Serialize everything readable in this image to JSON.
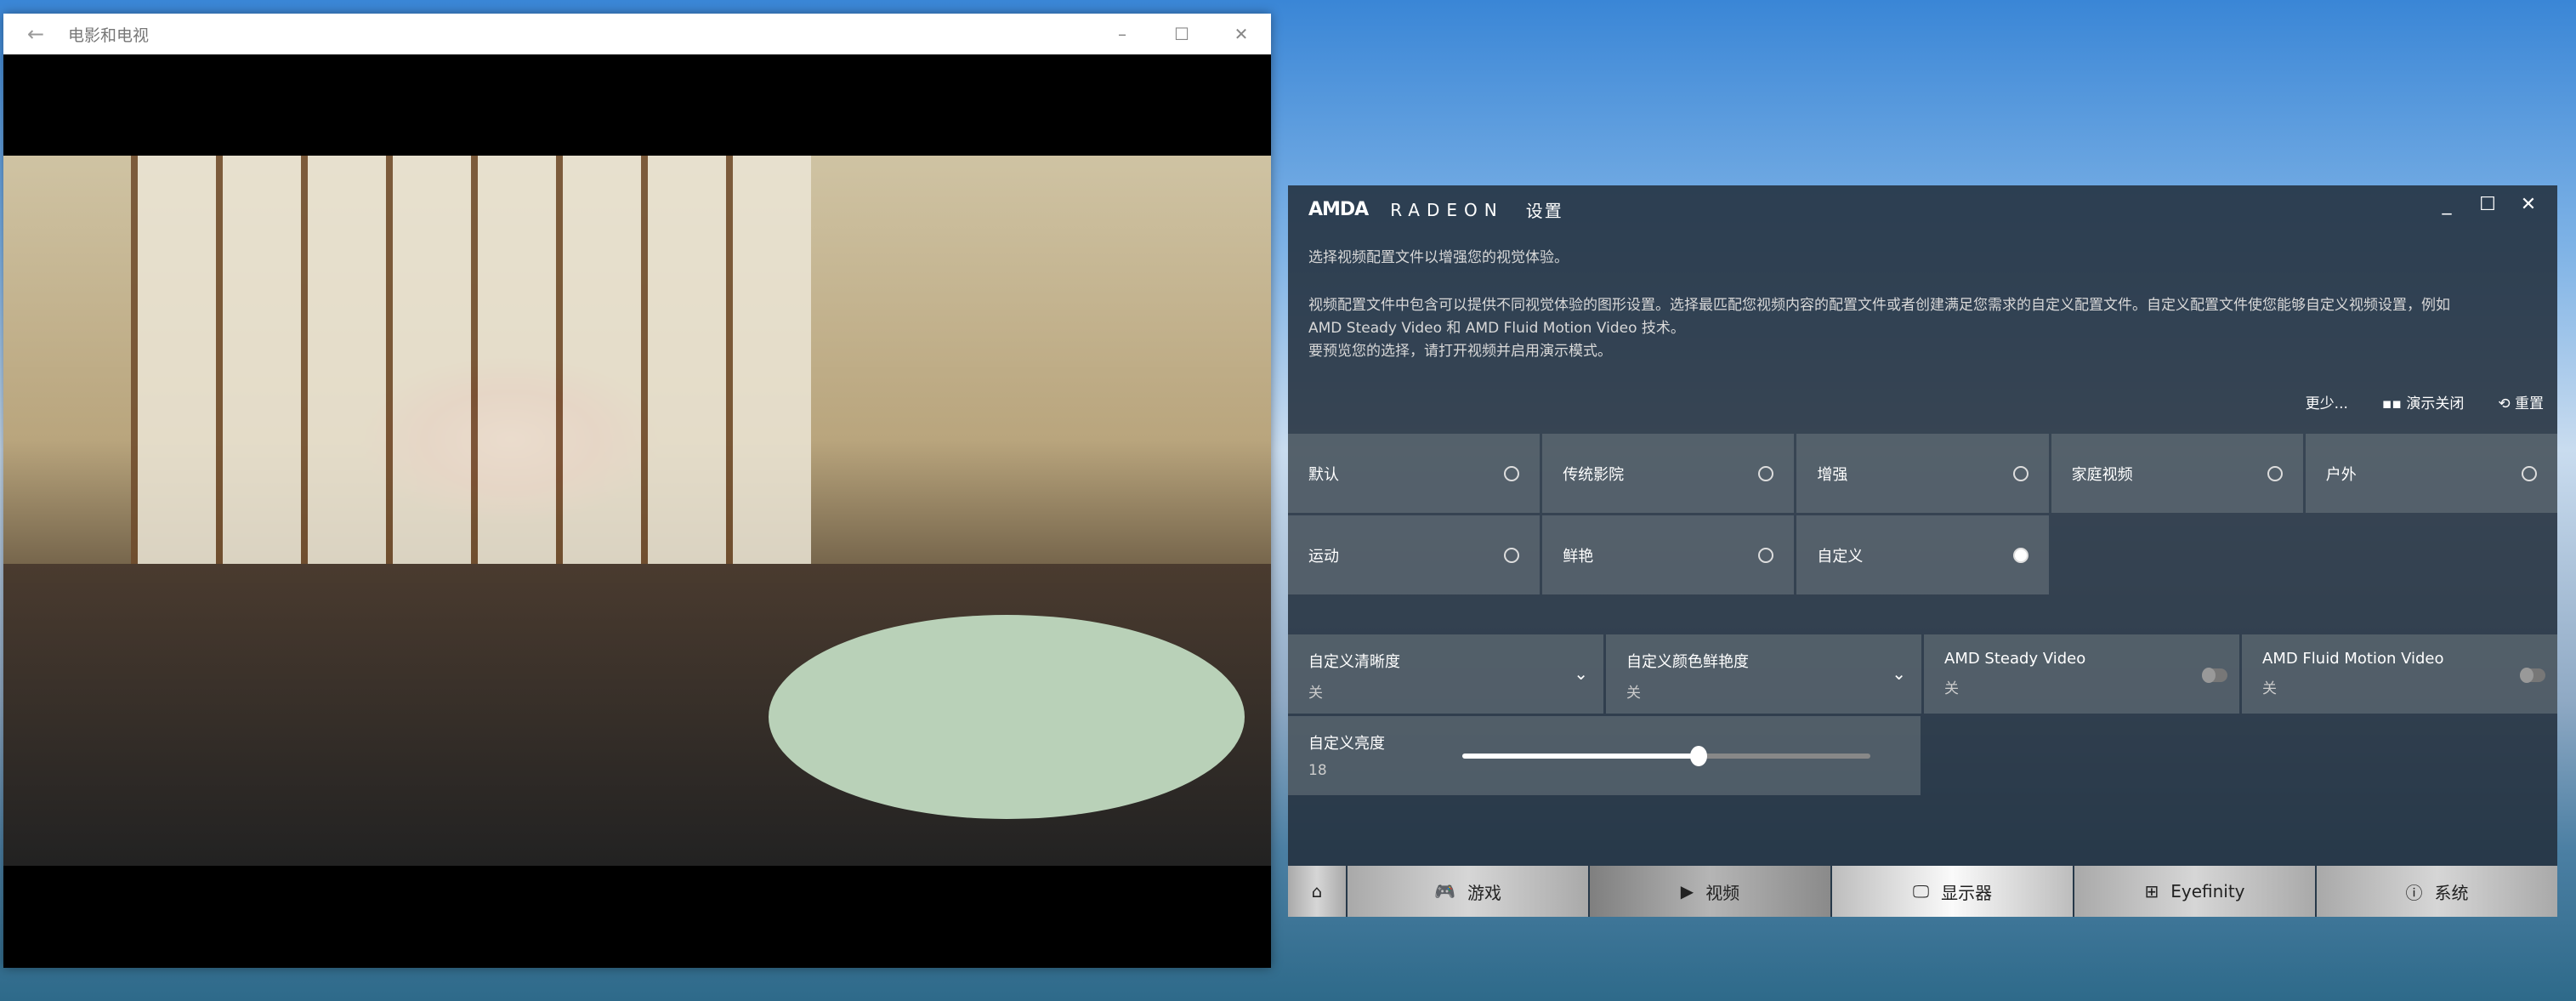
{
  "movies_window": {
    "title": "电影和电视",
    "back_icon": "arrow-left-icon",
    "controls": [
      "minimize",
      "maximize",
      "close"
    ]
  },
  "amd": {
    "logo": "AMDA",
    "brand": "RADEON",
    "title": "设置",
    "intro": "选择视频配置文件以增强您的视觉体验。",
    "desc1": "视频配置文件中包含可以提供不同视觉体验的图形设置。选择最匹配您视频内容的配置文件或者创建满足您需求的自定义配置文件。自定义配置文件使您能够自定义视频设置，例如",
    "desc2": "AMD Steady Video 和 AMD Fluid Motion Video 技术。",
    "desc3": "要预览您的选择，请打开视频并启用演示模式。",
    "actions": {
      "less": "更少...",
      "demo": "演示关闭",
      "reset": "重置"
    },
    "profiles": [
      {
        "label": "默认",
        "selected": false
      },
      {
        "label": "传统影院",
        "selected": false
      },
      {
        "label": "增强",
        "selected": false
      },
      {
        "label": "家庭视频",
        "selected": false
      },
      {
        "label": "户外",
        "selected": false
      },
      {
        "label": "运动",
        "selected": false
      },
      {
        "label": "鲜艳",
        "selected": false
      },
      {
        "label": "自定义",
        "selected": true
      }
    ],
    "settings": [
      {
        "label": "自定义清晰度",
        "value": "关",
        "type": "dropdown"
      },
      {
        "label": "自定义颜色鲜艳度",
        "value": "关",
        "type": "dropdown"
      },
      {
        "label": "AMD Steady Video",
        "value": "关",
        "type": "toggle"
      },
      {
        "label": "AMD Fluid Motion Video",
        "value": "关",
        "type": "toggle"
      }
    ],
    "brightness": {
      "label": "自定义亮度",
      "value": "18",
      "slider_fraction": 0.58
    },
    "nav": [
      {
        "label": "",
        "icon": "home-icon"
      },
      {
        "label": "游戏",
        "icon": "gamepad-icon"
      },
      {
        "label": "视频",
        "icon": "play-icon"
      },
      {
        "label": "显示器",
        "icon": "monitor-icon",
        "active": true
      },
      {
        "label": "Eyefinity",
        "icon": "eyefinity-icon"
      },
      {
        "label": "系统",
        "icon": "info-icon"
      }
    ]
  }
}
